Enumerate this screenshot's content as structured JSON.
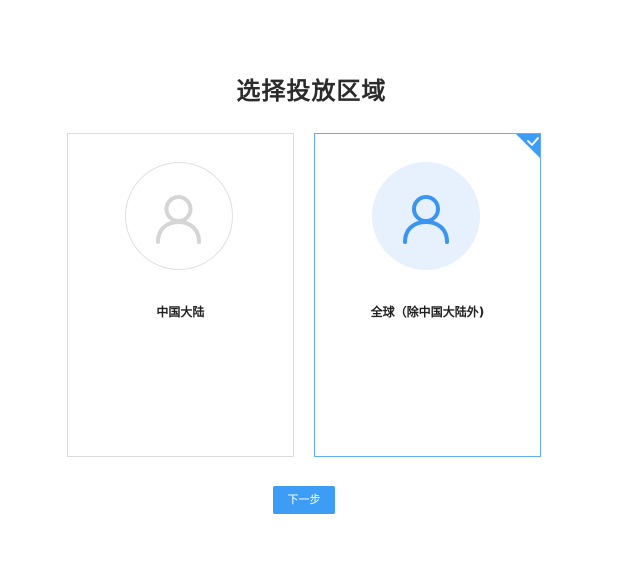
{
  "page": {
    "title": "选择投放区域"
  },
  "regions": [
    {
      "label": "中国大陆",
      "selected": false,
      "icon": "user-icon"
    },
    {
      "label": "全球（除中国大陆外)",
      "selected": true,
      "icon": "user-icon"
    }
  ],
  "actions": {
    "next_label": "下一步"
  },
  "colors": {
    "accent": "#3d9df5",
    "selected_border": "#62adf2",
    "avatar_active_bg": "#e6f1fd",
    "icon_inactive": "#d5d5d5",
    "icon_active": "#3b95f0"
  }
}
